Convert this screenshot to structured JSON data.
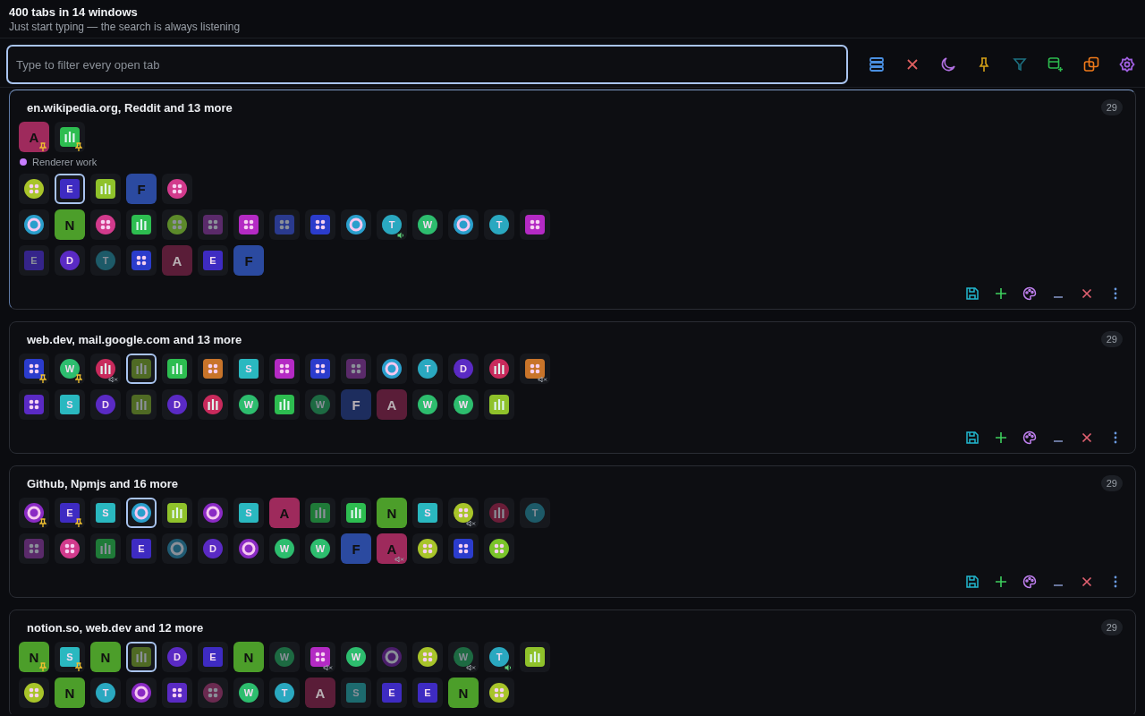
{
  "header": {
    "title": "400 tabs in 14 windows",
    "subtitle": "Just start typing — the search is always listening"
  },
  "search": {
    "placeholder": "Type to filter every open tab"
  },
  "windows": [
    {
      "title": "en.wikipedia.org, Reddit and 13 more",
      "count": "29",
      "current": true,
      "sections": [
        {
          "tabs": [
            {
              "kind": "tile",
              "letter": "A",
              "color": "#9e2a5c",
              "selected": false,
              "pinned": true,
              "muted": false,
              "audible": false,
              "discarded": false
            },
            {
              "kind": "squarebars",
              "color": "#2dbd50",
              "selected": false,
              "pinned": true,
              "muted": false,
              "audible": false,
              "discarded": false
            }
          ]
        },
        {
          "label": "Renderer work",
          "color": "#c77dff",
          "tabs": [
            {
              "kind": "rounddots",
              "color": "#a8c42a",
              "selected": false,
              "pinned": false,
              "muted": false,
              "audible": false,
              "discarded": false
            },
            {
              "kind": "squareletter",
              "letter": "E",
              "color": "#3e2bc2",
              "selected": true,
              "pinned": false,
              "muted": false,
              "audible": false,
              "discarded": false
            },
            {
              "kind": "squarebars",
              "color": "#8fc22b",
              "selected": false,
              "pinned": false,
              "muted": false,
              "audible": false,
              "discarded": false
            },
            {
              "kind": "tile",
              "letter": "F",
              "color": "#2b4aa0",
              "selected": false,
              "pinned": false,
              "muted": false,
              "audible": false,
              "discarded": false
            },
            {
              "kind": "rounddots",
              "color": "#d23a8c",
              "selected": false,
              "pinned": false,
              "muted": false,
              "audible": false,
              "discarded": false
            }
          ]
        },
        {
          "tabs": [
            {
              "kind": "ring",
              "color": "#2a9fcc",
              "selected": false,
              "pinned": false,
              "muted": false,
              "audible": false,
              "discarded": false
            },
            {
              "kind": "tile",
              "letter": "N",
              "color": "#4c9e2a",
              "selected": false,
              "pinned": false,
              "muted": false,
              "audible": false,
              "discarded": false
            },
            {
              "kind": "rounddots",
              "color": "#d23a8c",
              "selected": false,
              "pinned": false,
              "muted": false,
              "audible": false,
              "discarded": false
            },
            {
              "kind": "squarebars",
              "color": "#2dbd50",
              "selected": false,
              "pinned": false,
              "muted": false,
              "audible": false,
              "discarded": false
            },
            {
              "kind": "rounddots",
              "color": "#5c8a2a",
              "selected": false,
              "pinned": false,
              "muted": false,
              "audible": false,
              "discarded": true
            },
            {
              "kind": "squaredots",
              "color": "#5a2a6a",
              "selected": false,
              "pinned": false,
              "muted": false,
              "audible": false,
              "discarded": true
            },
            {
              "kind": "squaredots",
              "color": "#b42ac4",
              "selected": false,
              "pinned": false,
              "muted": false,
              "audible": false,
              "discarded": false
            },
            {
              "kind": "squaredots",
              "color": "#2a3a8e",
              "selected": false,
              "pinned": false,
              "muted": false,
              "audible": false,
              "discarded": true
            },
            {
              "kind": "squaredots",
              "color": "#2b3ccc",
              "selected": false,
              "pinned": false,
              "muted": false,
              "audible": false,
              "discarded": false
            },
            {
              "kind": "ring",
              "color": "#2a9fcc",
              "selected": false,
              "pinned": false,
              "muted": false,
              "audible": false,
              "discarded": false
            },
            {
              "kind": "roundletter",
              "letter": "T",
              "color": "#2aa8c0",
              "selected": false,
              "pinned": false,
              "muted": false,
              "audible": true,
              "discarded": false
            },
            {
              "kind": "roundletter",
              "letter": "W",
              "color": "#2dbd6e",
              "selected": false,
              "pinned": false,
              "muted": false,
              "audible": false,
              "discarded": false
            },
            {
              "kind": "ring",
              "color": "#2a9fcc",
              "selected": false,
              "pinned": false,
              "muted": false,
              "audible": false,
              "discarded": false
            },
            {
              "kind": "roundletter",
              "letter": "T",
              "color": "#2aa8c0",
              "selected": false,
              "pinned": false,
              "muted": false,
              "audible": false,
              "discarded": false
            },
            {
              "kind": "squaredots",
              "color": "#b42ac4",
              "selected": false,
              "pinned": false,
              "muted": false,
              "audible": false,
              "discarded": false
            },
            {
              "kind": "squareletter",
              "letter": "E",
              "color": "#35248a",
              "selected": false,
              "pinned": false,
              "muted": false,
              "audible": false,
              "discarded": true
            },
            {
              "kind": "roundletter",
              "letter": "D",
              "color": "#5a2ac4",
              "selected": false,
              "pinned": false,
              "muted": false,
              "audible": false,
              "discarded": false
            },
            {
              "kind": "roundletter",
              "letter": "T",
              "color": "#1d5a68",
              "selected": false,
              "pinned": false,
              "muted": false,
              "audible": false,
              "discarded": true
            },
            {
              "kind": "squaredots",
              "color": "#2b3ccc",
              "selected": false,
              "pinned": false,
              "muted": false,
              "audible": false,
              "discarded": false
            },
            {
              "kind": "tile",
              "letter": "A",
              "color": "#5a1d38",
              "selected": false,
              "pinned": false,
              "muted": false,
              "audible": false,
              "discarded": true
            },
            {
              "kind": "squareletter",
              "letter": "E",
              "color": "#3e2bc2",
              "selected": false,
              "pinned": false,
              "muted": false,
              "audible": false,
              "discarded": false
            },
            {
              "kind": "tile",
              "letter": "F",
              "color": "#2b4aa0",
              "selected": false,
              "pinned": false,
              "muted": false,
              "audible": false,
              "discarded": false
            }
          ]
        }
      ]
    },
    {
      "title": "web.dev, mail.google.com and 13 more",
      "count": "29",
      "current": false,
      "sections": [
        {
          "tabs": [
            {
              "kind": "squaredots",
              "color": "#2b3ccc",
              "selected": false,
              "pinned": true,
              "muted": false,
              "audible": false,
              "discarded": false
            },
            {
              "kind": "roundletter",
              "letter": "W",
              "color": "#2dbd6e",
              "selected": false,
              "pinned": true,
              "muted": false,
              "audible": false,
              "discarded": false
            },
            {
              "kind": "roundbars",
              "color": "#c82a5c",
              "selected": false,
              "pinned": false,
              "muted": true,
              "audible": false,
              "discarded": false
            },
            {
              "kind": "squarebars",
              "color": "#4f6a24",
              "selected": true,
              "pinned": false,
              "muted": false,
              "audible": false,
              "discarded": true
            },
            {
              "kind": "squarebars",
              "color": "#2dbd50",
              "selected": false,
              "pinned": false,
              "muted": false,
              "audible": false,
              "discarded": false
            },
            {
              "kind": "squaredots",
              "color": "#c8742a",
              "selected": false,
              "pinned": false,
              "muted": false,
              "audible": false,
              "discarded": false
            },
            {
              "kind": "squareletter",
              "letter": "S",
              "color": "#2ab8c0",
              "selected": false,
              "pinned": false,
              "muted": false,
              "audible": false,
              "discarded": false
            },
            {
              "kind": "squaredots",
              "color": "#b42ac4",
              "selected": false,
              "pinned": false,
              "muted": false,
              "audible": false,
              "discarded": false
            },
            {
              "kind": "squaredots",
              "color": "#2b3ccc",
              "selected": false,
              "pinned": false,
              "muted": false,
              "audible": false,
              "discarded": false
            },
            {
              "kind": "squaredots",
              "color": "#5a2a6a",
              "selected": false,
              "pinned": false,
              "muted": false,
              "audible": false,
              "discarded": true
            },
            {
              "kind": "ring",
              "color": "#2a9fcc",
              "selected": false,
              "pinned": false,
              "muted": false,
              "audible": false,
              "discarded": false
            },
            {
              "kind": "roundletter",
              "letter": "T",
              "color": "#2aa8c0",
              "selected": false,
              "pinned": false,
              "muted": false,
              "audible": false,
              "discarded": false
            },
            {
              "kind": "roundletter",
              "letter": "D",
              "color": "#5a2ac4",
              "selected": false,
              "pinned": false,
              "muted": false,
              "audible": false,
              "discarded": false
            },
            {
              "kind": "roundbars",
              "color": "#c82a5c",
              "selected": false,
              "pinned": false,
              "muted": false,
              "audible": false,
              "discarded": false
            },
            {
              "kind": "squaredots",
              "color": "#c8742a",
              "selected": false,
              "pinned": false,
              "muted": true,
              "audible": false,
              "discarded": false
            },
            {
              "kind": "squaredots",
              "color": "#5a2ac4",
              "selected": false,
              "pinned": false,
              "muted": false,
              "audible": false,
              "discarded": false
            },
            {
              "kind": "squareletter",
              "letter": "S",
              "color": "#2ab8c0",
              "selected": false,
              "pinned": false,
              "muted": false,
              "audible": false,
              "discarded": false
            },
            {
              "kind": "roundletter",
              "letter": "D",
              "color": "#5a2ac4",
              "selected": false,
              "pinned": false,
              "muted": false,
              "audible": false,
              "discarded": false
            },
            {
              "kind": "squarebars",
              "color": "#4f6a24",
              "selected": false,
              "pinned": false,
              "muted": false,
              "audible": false,
              "discarded": true
            },
            {
              "kind": "roundletter",
              "letter": "D",
              "color": "#5a2ac4",
              "selected": false,
              "pinned": false,
              "muted": false,
              "audible": false,
              "discarded": false
            },
            {
              "kind": "roundbars",
              "color": "#c82a5c",
              "selected": false,
              "pinned": false,
              "muted": false,
              "audible": false,
              "discarded": false
            },
            {
              "kind": "roundletter",
              "letter": "W",
              "color": "#2dbd6e",
              "selected": false,
              "pinned": false,
              "muted": false,
              "audible": false,
              "discarded": false
            },
            {
              "kind": "squarebars",
              "color": "#2dbd50",
              "selected": false,
              "pinned": false,
              "muted": false,
              "audible": false,
              "discarded": false
            },
            {
              "kind": "roundletter",
              "letter": "W",
              "color": "#1d6a42",
              "selected": false,
              "pinned": false,
              "muted": false,
              "audible": false,
              "discarded": true
            },
            {
              "kind": "tile",
              "letter": "F",
              "color": "#1d2d5e",
              "selected": false,
              "pinned": false,
              "muted": false,
              "audible": false,
              "discarded": true
            },
            {
              "kind": "tile",
              "letter": "A",
              "color": "#5a1d38",
              "selected": false,
              "pinned": false,
              "muted": false,
              "audible": false,
              "discarded": true
            },
            {
              "kind": "roundletter",
              "letter": "W",
              "color": "#2dbd6e",
              "selected": false,
              "pinned": false,
              "muted": false,
              "audible": false,
              "discarded": false
            },
            {
              "kind": "roundletter",
              "letter": "W",
              "color": "#2dbd6e",
              "selected": false,
              "pinned": false,
              "muted": false,
              "audible": false,
              "discarded": false
            },
            {
              "kind": "squarebars",
              "color": "#8fc22b",
              "selected": false,
              "pinned": false,
              "muted": false,
              "audible": false,
              "discarded": false
            }
          ]
        }
      ]
    },
    {
      "title": "Github, Npmjs and 16 more",
      "count": "29",
      "current": false,
      "sections": [
        {
          "tabs": [
            {
              "kind": "ring",
              "color": "#8a2ac4",
              "selected": false,
              "pinned": true,
              "muted": false,
              "audible": false,
              "discarded": false
            },
            {
              "kind": "squareletter",
              "letter": "E",
              "color": "#3e2bc2",
              "selected": false,
              "pinned": true,
              "muted": false,
              "audible": false,
              "discarded": false
            },
            {
              "kind": "squareletter",
              "letter": "S",
              "color": "#2ab8c0",
              "selected": false,
              "pinned": false,
              "muted": false,
              "audible": false,
              "discarded": false
            },
            {
              "kind": "ring",
              "color": "#2a9fcc",
              "selected": true,
              "pinned": false,
              "muted": false,
              "audible": false,
              "discarded": false
            },
            {
              "kind": "squarebars",
              "color": "#8fc22b",
              "selected": false,
              "pinned": false,
              "muted": false,
              "audible": false,
              "discarded": false
            },
            {
              "kind": "ring",
              "color": "#8a2ac4",
              "selected": false,
              "pinned": false,
              "muted": false,
              "audible": false,
              "discarded": false
            },
            {
              "kind": "squareletter",
              "letter": "S",
              "color": "#2ab8c0",
              "selected": false,
              "pinned": false,
              "muted": false,
              "audible": false,
              "discarded": false
            },
            {
              "kind": "tile",
              "letter": "A",
              "color": "#9e2a5c",
              "selected": false,
              "pinned": false,
              "muted": false,
              "audible": false,
              "discarded": false
            },
            {
              "kind": "squarebars",
              "color": "#1f7a38",
              "selected": false,
              "pinned": false,
              "muted": false,
              "audible": false,
              "discarded": true
            },
            {
              "kind": "squarebars",
              "color": "#2dbd50",
              "selected": false,
              "pinned": false,
              "muted": false,
              "audible": false,
              "discarded": false
            },
            {
              "kind": "tile",
              "letter": "N",
              "color": "#4c9e2a",
              "selected": false,
              "pinned": false,
              "muted": false,
              "audible": false,
              "discarded": false
            },
            {
              "kind": "squareletter",
              "letter": "S",
              "color": "#2ab8c0",
              "selected": false,
              "pinned": false,
              "muted": false,
              "audible": false,
              "discarded": false
            },
            {
              "kind": "rounddots",
              "color": "#a8c42a",
              "selected": false,
              "pinned": false,
              "muted": true,
              "audible": false,
              "discarded": false
            },
            {
              "kind": "roundbars",
              "color": "#6a1d38",
              "selected": false,
              "pinned": false,
              "muted": false,
              "audible": false,
              "discarded": true
            },
            {
              "kind": "roundletter",
              "letter": "T",
              "color": "#1d5a68",
              "selected": false,
              "pinned": false,
              "muted": false,
              "audible": false,
              "discarded": true
            },
            {
              "kind": "squaredots",
              "color": "#5a2a6a",
              "selected": false,
              "pinned": false,
              "muted": false,
              "audible": false,
              "discarded": true
            },
            {
              "kind": "rounddots",
              "color": "#d23a8c",
              "selected": false,
              "pinned": false,
              "muted": false,
              "audible": false,
              "discarded": false
            },
            {
              "kind": "squarebars",
              "color": "#1f7a38",
              "selected": false,
              "pinned": false,
              "muted": false,
              "audible": false,
              "discarded": true
            },
            {
              "kind": "squareletter",
              "letter": "E",
              "color": "#3e2bc2",
              "selected": false,
              "pinned": false,
              "muted": false,
              "audible": false,
              "discarded": false
            },
            {
              "kind": "ring",
              "color": "#1f5a72",
              "selected": false,
              "pinned": false,
              "muted": false,
              "audible": false,
              "discarded": true
            },
            {
              "kind": "roundletter",
              "letter": "D",
              "color": "#5a2ac4",
              "selected": false,
              "pinned": false,
              "muted": false,
              "audible": false,
              "discarded": false
            },
            {
              "kind": "ring",
              "color": "#8a2ac4",
              "selected": false,
              "pinned": false,
              "muted": false,
              "audible": false,
              "discarded": false
            },
            {
              "kind": "roundletter",
              "letter": "W",
              "color": "#2dbd6e",
              "selected": false,
              "pinned": false,
              "muted": false,
              "audible": false,
              "discarded": false
            },
            {
              "kind": "roundletter",
              "letter": "W",
              "color": "#2dbd6e",
              "selected": false,
              "pinned": false,
              "muted": false,
              "audible": false,
              "discarded": false
            },
            {
              "kind": "tile",
              "letter": "F",
              "color": "#2b4aa0",
              "selected": false,
              "pinned": false,
              "muted": false,
              "audible": false,
              "discarded": false
            },
            {
              "kind": "tile",
              "letter": "A",
              "color": "#9e2a5c",
              "selected": false,
              "pinned": false,
              "muted": true,
              "audible": false,
              "discarded": false
            },
            {
              "kind": "rounddots",
              "color": "#a8c42a",
              "selected": false,
              "pinned": false,
              "muted": false,
              "audible": false,
              "discarded": false
            },
            {
              "kind": "squaredots",
              "color": "#2b3ccc",
              "selected": false,
              "pinned": false,
              "muted": false,
              "audible": false,
              "discarded": false
            },
            {
              "kind": "rounddots",
              "color": "#7ac42a",
              "selected": false,
              "pinned": false,
              "muted": false,
              "audible": false,
              "discarded": false
            }
          ]
        }
      ]
    },
    {
      "title": "notion.so, web.dev and 12 more",
      "count": "29",
      "current": false,
      "sections": [
        {
          "tabs": [
            {
              "kind": "tile",
              "letter": "N",
              "color": "#4c9e2a",
              "selected": false,
              "pinned": true,
              "muted": false,
              "audible": false,
              "discarded": false
            },
            {
              "kind": "squareletter",
              "letter": "S",
              "color": "#2ab8c0",
              "selected": false,
              "pinned": true,
              "muted": false,
              "audible": false,
              "discarded": false
            },
            {
              "kind": "tile",
              "letter": "N",
              "color": "#4c9e2a",
              "selected": false,
              "pinned": false,
              "muted": false,
              "audible": false,
              "discarded": false
            },
            {
              "kind": "squarebars",
              "color": "#4f6a24",
              "selected": true,
              "pinned": false,
              "muted": false,
              "audible": false,
              "discarded": true
            },
            {
              "kind": "roundletter",
              "letter": "D",
              "color": "#5a2ac4",
              "selected": false,
              "pinned": false,
              "muted": false,
              "audible": false,
              "discarded": false
            },
            {
              "kind": "squareletter",
              "letter": "E",
              "color": "#3e2bc2",
              "selected": false,
              "pinned": false,
              "muted": false,
              "audible": false,
              "discarded": false
            },
            {
              "kind": "tile",
              "letter": "N",
              "color": "#4c9e2a",
              "selected": false,
              "pinned": false,
              "muted": false,
              "audible": false,
              "discarded": false
            },
            {
              "kind": "roundletter",
              "letter": "W",
              "color": "#1d6a42",
              "selected": false,
              "pinned": false,
              "muted": false,
              "audible": false,
              "discarded": true
            },
            {
              "kind": "squaredots",
              "color": "#b42ac4",
              "selected": false,
              "pinned": false,
              "muted": true,
              "audible": false,
              "discarded": false
            },
            {
              "kind": "roundletter",
              "letter": "W",
              "color": "#2dbd6e",
              "selected": false,
              "pinned": false,
              "muted": false,
              "audible": false,
              "discarded": false
            },
            {
              "kind": "ring",
              "color": "#4a1d6a",
              "selected": false,
              "pinned": false,
              "muted": false,
              "audible": false,
              "discarded": true
            },
            {
              "kind": "rounddots",
              "color": "#a8c42a",
              "selected": false,
              "pinned": false,
              "muted": false,
              "audible": false,
              "discarded": false
            },
            {
              "kind": "roundletter",
              "letter": "W",
              "color": "#1d6a42",
              "selected": false,
              "pinned": false,
              "muted": true,
              "audible": false,
              "discarded": true
            },
            {
              "kind": "roundletter",
              "letter": "T",
              "color": "#2aa8c0",
              "selected": false,
              "pinned": false,
              "muted": false,
              "audible": true,
              "discarded": false
            },
            {
              "kind": "squarebars",
              "color": "#8fc22b",
              "selected": false,
              "pinned": false,
              "muted": false,
              "audible": false,
              "discarded": false
            },
            {
              "kind": "rounddots",
              "color": "#a8c42a",
              "selected": false,
              "pinned": false,
              "muted": false,
              "audible": false,
              "discarded": false
            },
            {
              "kind": "tile",
              "letter": "N",
              "color": "#4c9e2a",
              "selected": false,
              "pinned": false,
              "muted": false,
              "audible": false,
              "discarded": false
            },
            {
              "kind": "roundletter",
              "letter": "T",
              "color": "#2aa8c0",
              "selected": false,
              "pinned": false,
              "muted": false,
              "audible": false,
              "discarded": false
            },
            {
              "kind": "ring",
              "color": "#8a2ac4",
              "selected": false,
              "pinned": false,
              "muted": false,
              "audible": false,
              "discarded": false
            },
            {
              "kind": "squaredots",
              "color": "#5a2ac4",
              "selected": false,
              "pinned": false,
              "muted": false,
              "audible": false,
              "discarded": false
            },
            {
              "kind": "rounddots",
              "color": "#6a2a50",
              "selected": false,
              "pinned": false,
              "muted": false,
              "audible": false,
              "discarded": true
            },
            {
              "kind": "roundletter",
              "letter": "W",
              "color": "#2dbd6e",
              "selected": false,
              "pinned": false,
              "muted": false,
              "audible": false,
              "discarded": false
            },
            {
              "kind": "roundletter",
              "letter": "T",
              "color": "#2aa8c0",
              "selected": false,
              "pinned": false,
              "muted": false,
              "audible": false,
              "discarded": false
            },
            {
              "kind": "tile",
              "letter": "A",
              "color": "#5a1d38",
              "selected": false,
              "pinned": false,
              "muted": false,
              "audible": false,
              "discarded": true
            },
            {
              "kind": "squareletter",
              "letter": "S",
              "color": "#1d6a6e",
              "selected": false,
              "pinned": false,
              "muted": false,
              "audible": false,
              "discarded": true
            },
            {
              "kind": "squareletter",
              "letter": "E",
              "color": "#3e2bc2",
              "selected": false,
              "pinned": false,
              "muted": false,
              "audible": false,
              "discarded": false
            },
            {
              "kind": "squareletter",
              "letter": "E",
              "color": "#3e2bc2",
              "selected": false,
              "pinned": false,
              "muted": false,
              "audible": false,
              "discarded": false
            },
            {
              "kind": "tile",
              "letter": "N",
              "color": "#4c9e2a",
              "selected": false,
              "pinned": false,
              "muted": false,
              "audible": false,
              "discarded": false
            },
            {
              "kind": "rounddots",
              "color": "#a8c42a",
              "selected": false,
              "pinned": false,
              "muted": false,
              "audible": false,
              "discarded": false
            }
          ]
        }
      ]
    }
  ]
}
